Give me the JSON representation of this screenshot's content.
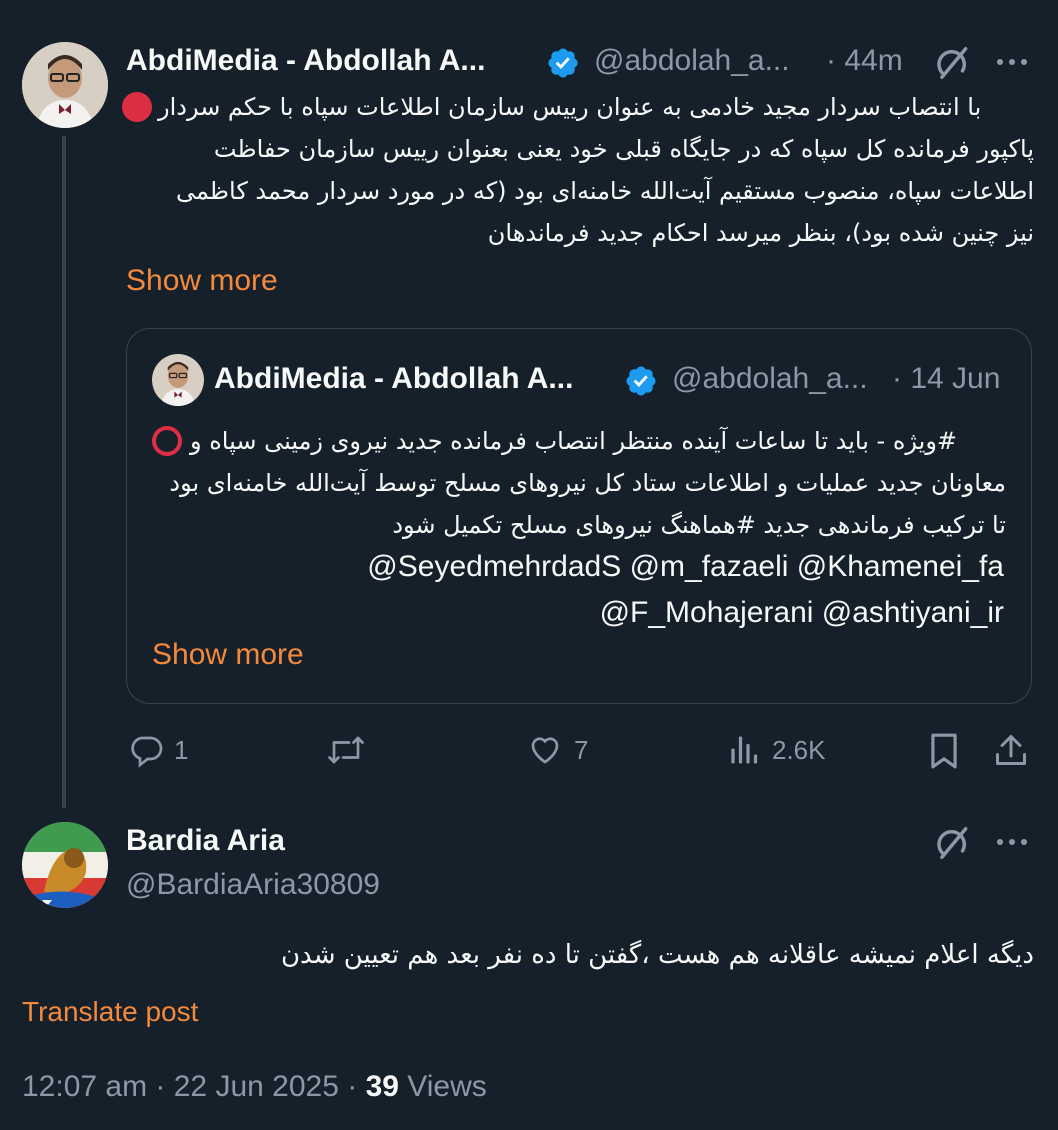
{
  "colors": {
    "background": "#15202b",
    "text": "#f7f9f9",
    "muted": "#8b98a5",
    "accent": "#f4893b",
    "verified": "#1d9bf0",
    "border": "#38444d"
  },
  "post1": {
    "display_name": "AbdiMedia - Abdollah A...",
    "handle": "@abdolah_a...",
    "time": "· 44m",
    "lines": [
      "با انتصاب سردار مجید خادمی به عنوان رییس سازمان اطلاعات سپاه با حکم سردار",
      "پاکپور فرمانده کل سپاه که در جایگاه قبلی خود یعنی بعنوان رییس سازمان حفاظت",
      "اطلاعات سپاه، منصوب مستقیم آیت‌الله خامنه‌ای بود (که در مورد سردار محمد کاظمی",
      "نیز چنین شده بود)، بنظر میرسد احکام جدید فرماندهان"
    ],
    "show_more": "Show more",
    "quote": {
      "display_name": "AbdiMedia - Abdollah A...",
      "handle": "@abdolah_a...",
      "time": "· 14 Jun",
      "lines": [
        "#ویژه - باید تا ساعات آینده منتظر انتصاب فرمانده جدید نیروی زمینی سپاه و",
        "معاونان جدید عملیات و اطلاعات ستاد کل نیروهای مسلح توسط آیت‌الله خامنه‌ای بود",
        "تا ترکیب فرماندهی جدید #هماهنگ نیروهای مسلح تکمیل شود"
      ],
      "mentions": [
        "@SeyedmehrdadS @m_fazaeli @Khamenei_fa",
        "@F_Mohajerani @ashtiyani_ir"
      ],
      "show_more": "Show more"
    },
    "actions": {
      "replies": "1",
      "reposts": "",
      "likes": "7",
      "views": "2.6K"
    }
  },
  "post2": {
    "display_name": "Bardia Aria",
    "handle": "@BardiaAria30809",
    "text": "دیگه اعلام نمیشه عاقلانه هم هست ،گفتن تا ده نفر بعد هم تعیین شدن",
    "translate": "Translate post",
    "timestamp": "12:07 am · 22 Jun 2025 ·",
    "views_count": "39",
    "views_label": "Views"
  },
  "icons": [
    "grok-icon",
    "more-icon",
    "verified-icon",
    "reply-icon",
    "repost-icon",
    "like-icon",
    "views-icon",
    "bookmark-icon",
    "share-icon",
    "red-circle-icon",
    "red-ring-icon"
  ]
}
